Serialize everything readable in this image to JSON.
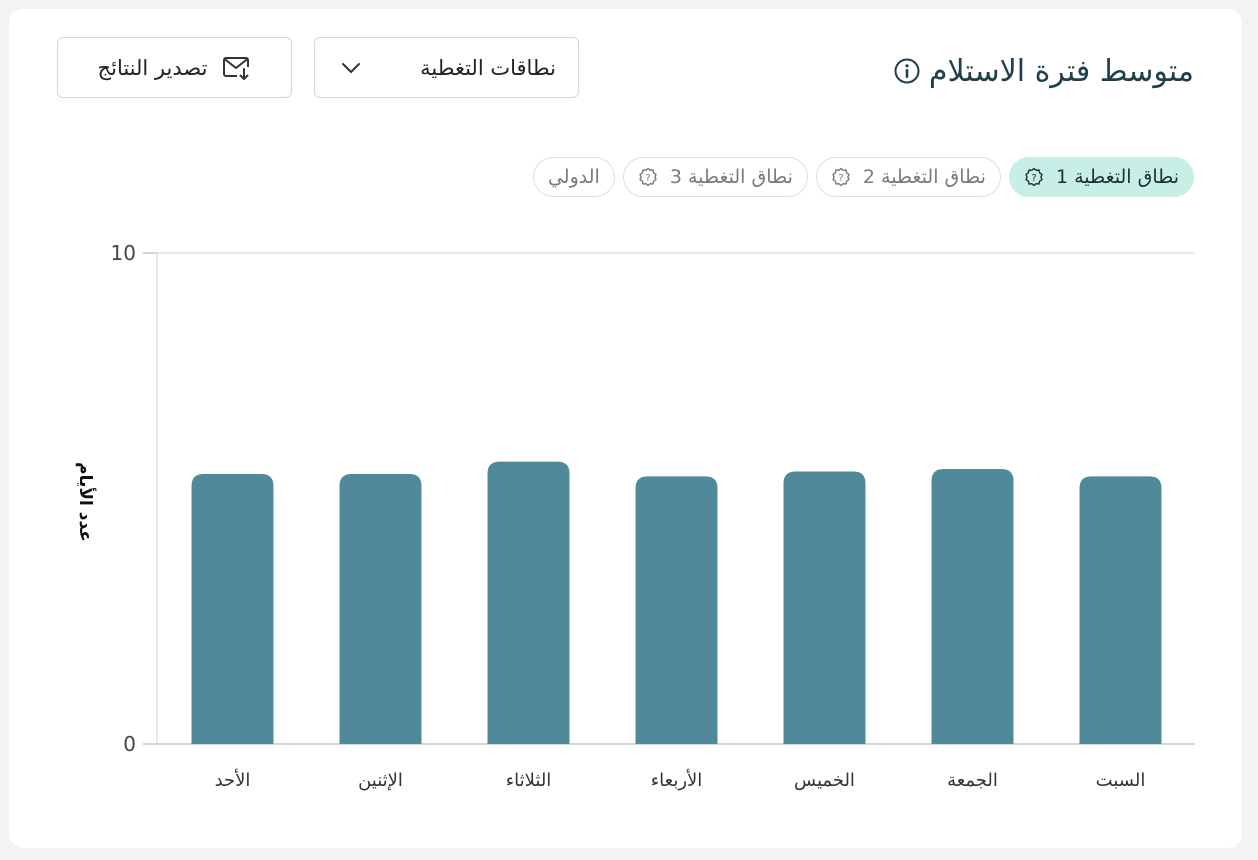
{
  "header": {
    "title": "متوسط فترة الاستلام",
    "coverage_dropdown_label": "نطاقات التغطية",
    "export_label": "تصدير النتائج"
  },
  "tabs": [
    {
      "label": "نطاق التغطية 1",
      "active": true,
      "icon": "question-badge-icon"
    },
    {
      "label": "نطاق التغطية 2",
      "active": false,
      "icon": "question-badge-icon"
    },
    {
      "label": "نطاق التغطية 3",
      "active": false,
      "icon": "question-badge-icon"
    },
    {
      "label": "الدولي",
      "active": false
    }
  ],
  "colors": {
    "bar": "#508a9a",
    "active_tab_bg": "#c8efe6",
    "title": "#1f3f4c"
  },
  "chart_data": {
    "type": "bar",
    "ylabel": "عدد الأيام",
    "ylim": [
      0,
      10
    ],
    "yticks": [
      "0",
      "10"
    ],
    "categories": [
      "الأحد",
      "الإثنين",
      "الثلاثاء",
      "الأربعاء",
      "الخميس",
      "الجمعة",
      "السبت"
    ],
    "values": [
      5.5,
      5.5,
      5.75,
      5.45,
      5.55,
      5.6,
      5.45
    ],
    "grid": false,
    "legend": "none"
  }
}
